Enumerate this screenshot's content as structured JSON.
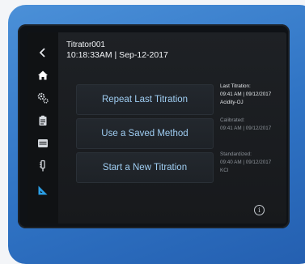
{
  "device": {
    "name": "Titrator001",
    "datetime": "10:18:33AM | Sep-12-2017"
  },
  "sidebar": {
    "items": [
      {
        "icon": "chevron-left-icon"
      },
      {
        "icon": "home-icon"
      },
      {
        "icon": "settings-gears-icon"
      },
      {
        "icon": "clipboard-icon"
      },
      {
        "icon": "folder-icon"
      },
      {
        "icon": "electrode-icon"
      },
      {
        "icon": "ruler-triangle-icon"
      }
    ]
  },
  "actions": {
    "repeat_label": "Repeat Last Titration",
    "saved_label": "Use a Saved Method",
    "new_label": "Start a New Titration"
  },
  "info": {
    "last_titration": {
      "label": "Last Titration:",
      "value": "09:41 AM | 09/12/2017",
      "method": "Acidity-OJ"
    },
    "calibrated": {
      "label": "Calibrated:",
      "value": "09:41 AM | 09/12/2017"
    },
    "standardized": {
      "label": "Standardized:",
      "value": "09:40 AM | 09/12/2017",
      "reagent": "KCl"
    }
  },
  "info_icon_glyph": "i",
  "colors": {
    "bezel": "#3a7fd0",
    "screen": "#1b1e21",
    "button_text": "#9fcdf2"
  }
}
